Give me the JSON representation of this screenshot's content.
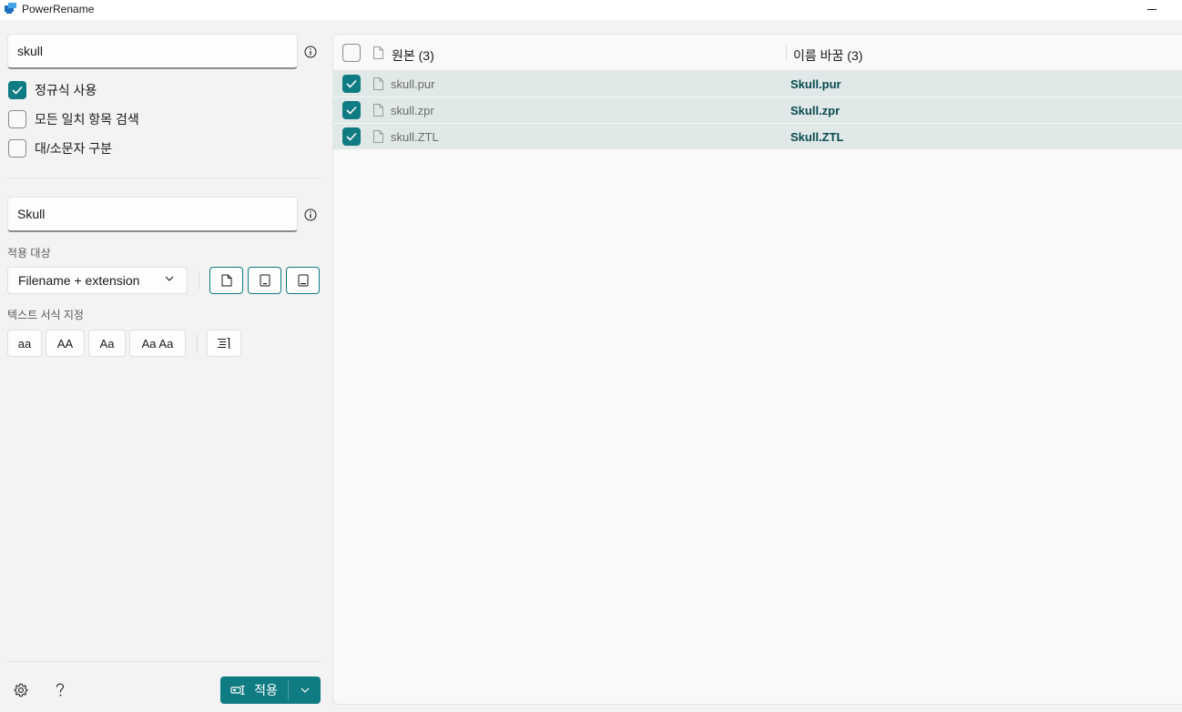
{
  "window": {
    "title": "PowerRename"
  },
  "search": {
    "value": "skull"
  },
  "options": [
    {
      "label": "정규식 사용",
      "checked": true
    },
    {
      "label": "모든 일치 항목 검색",
      "checked": false
    },
    {
      "label": "대/소문자 구분",
      "checked": false
    }
  ],
  "replace": {
    "value": "Skull"
  },
  "apply_to": {
    "section_label": "적용 대상",
    "selected": "Filename + extension"
  },
  "text_format": {
    "section_label": "텍스트 서식 지정",
    "buttons": [
      "aa",
      "AA",
      "Aa",
      "Aa Aa"
    ]
  },
  "footer": {
    "apply_label": "적용"
  },
  "file_list": {
    "original_header": "원본 (3)",
    "renamed_header": "이름 바꿈 (3)",
    "rows": [
      {
        "original": "skull.pur",
        "renamed": "Skull.pur",
        "checked": true
      },
      {
        "original": "skull.zpr",
        "renamed": "Skull.zpr",
        "checked": true
      },
      {
        "original": "skull.ZTL",
        "renamed": "Skull.ZTL",
        "checked": true
      }
    ]
  },
  "colors": {
    "accent": "#0f7b83",
    "row_highlight": "#e0e9e8",
    "renamed_text": "#0b4a50"
  }
}
